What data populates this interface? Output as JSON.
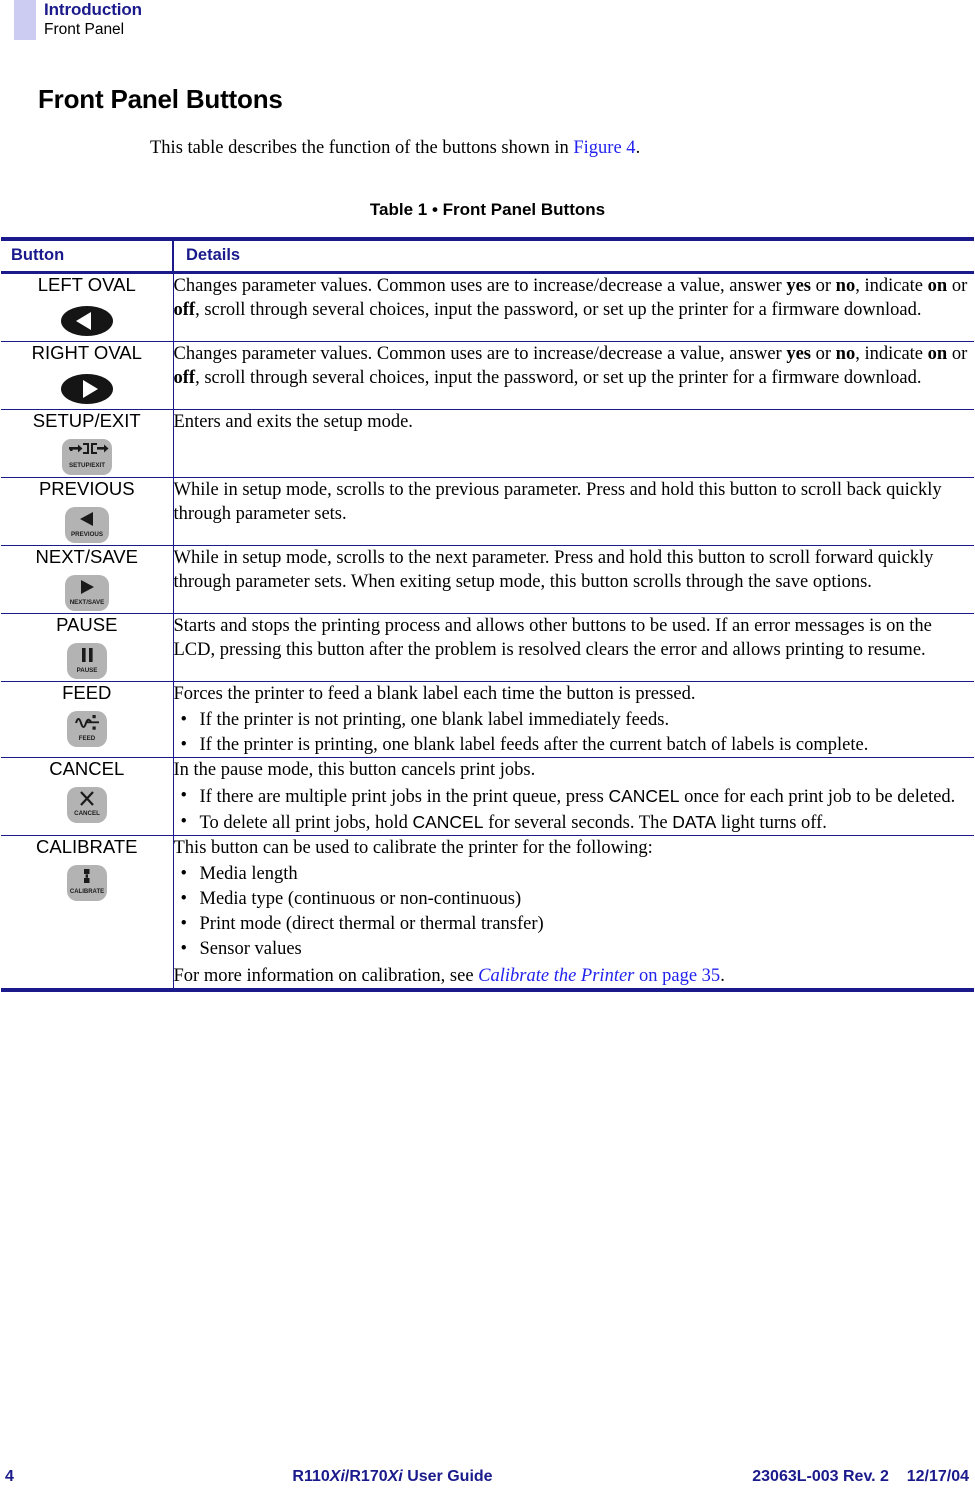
{
  "header": {
    "chapter": "Introduction",
    "section": "Front Panel"
  },
  "heading": "Front Panel Buttons",
  "intro": {
    "before": "This table describes the function of the buttons shown in ",
    "xref": "Figure 4",
    "after": "."
  },
  "table": {
    "caption": "Table 1 • Front Panel Buttons",
    "columns": [
      "Button",
      "Details"
    ],
    "rows": [
      {
        "button": "LEFT OVAL",
        "icon": "left-oval-button-icon",
        "body": {
          "p1_a": "Changes parameter values. Common uses are to increase/decrease a value, answer ",
          "b1": "yes",
          "p1_b": " or ",
          "b2": "no",
          "p1_c": ", indicate ",
          "b3": "on",
          "p1_d": " or ",
          "b4": "off",
          "p1_e": ", scroll through several choices, input the password, or set up the printer for a firmware download."
        }
      },
      {
        "button": "RIGHT OVAL",
        "icon": "right-oval-button-icon",
        "body": {
          "p1_a": "Changes parameter values. Common uses are to increase/decrease a value, answer ",
          "b1": "yes",
          "p1_b": " or ",
          "b2": "no",
          "p1_c": ", indicate ",
          "b3": "on",
          "p1_d": " or ",
          "b4": "off",
          "p1_e": ", scroll through several choices, input the password, or set up the printer for a firmware download."
        }
      },
      {
        "button": "SETUP/EXIT",
        "icon": "setup-exit-button-icon",
        "icon_caption": "SETUP/EXIT",
        "text": "Enters and exits the setup mode."
      },
      {
        "button": "PREVIOUS",
        "icon": "previous-button-icon",
        "icon_caption": "PREVIOUS",
        "text": "While in setup mode, scrolls to the previous parameter. Press and hold this button to scroll back quickly through parameter sets."
      },
      {
        "button": "NEXT/SAVE",
        "icon": "next-save-button-icon",
        "icon_caption": "NEXT/SAVE",
        "text": "While in setup mode, scrolls to the next parameter. Press and hold this button to scroll forward quickly through parameter sets. When exiting setup mode, this button scrolls through the save options."
      },
      {
        "button": "PAUSE",
        "icon": "pause-button-icon",
        "icon_caption": "PAUSE",
        "text": "Starts and stops the printing process and allows other buttons to be used. If an error messages is on the LCD, pressing this button after the problem is resolved clears the error and allows printing to resume."
      },
      {
        "button": "FEED",
        "icon": "feed-button-icon",
        "icon_caption": "FEED",
        "text": "Forces the printer to feed a blank label each time the button is pressed.",
        "bullets": [
          "If the printer is not printing, one blank label immediately feeds.",
          "If the printer is printing, one blank label feeds after the current batch of labels is complete."
        ]
      },
      {
        "button": "CANCEL",
        "icon": "cancel-button-icon",
        "icon_caption": "CANCEL",
        "text": "In the pause mode, this button cancels print jobs.",
        "bullet1": {
          "a": "If there are multiple print jobs in the print queue, press ",
          "k1": "CANCEL",
          "b": " once for each print job to be deleted."
        },
        "bullet2": {
          "a": "To delete all print jobs, hold ",
          "k1": "CANCEL",
          "b": " for several seconds. The ",
          "k2": "DATA",
          "c": " light turns off."
        }
      },
      {
        "button": "CALIBRATE",
        "icon": "calibrate-button-icon",
        "icon_caption": "CALIBRATE",
        "text": " This button can be used to calibrate the printer for the following:",
        "bullets": [
          "Media length",
          "Media type (continuous or non-continuous)",
          "Print mode (direct thermal or thermal transfer)",
          "Sensor values"
        ],
        "footnote": {
          "a": "For more information on calibration, see ",
          "xref": "Calibrate the Printer",
          "b": " on page 35",
          "c": "."
        }
      }
    ]
  },
  "footer": {
    "page": "4",
    "title_a": "R110",
    "title_i1": "Xi",
    "title_b": "/R170",
    "title_i2": "Xi",
    "title_c": " User Guide",
    "rev": "23063L-003 Rev. 2    12/17/04"
  },
  "colors": {
    "navy": "#1a1a8c",
    "link_blue": "#2222ee",
    "header_swatch": "#ccccf2",
    "button_gray": "#b3b3b3"
  }
}
